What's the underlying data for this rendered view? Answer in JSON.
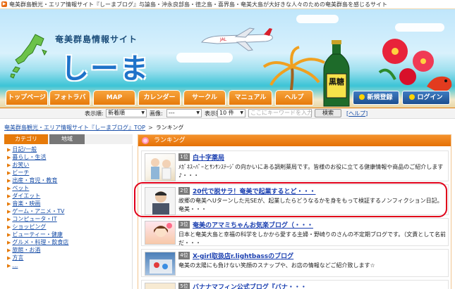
{
  "topbar": {
    "text": "奄美群島観光・エリア情報サイト『しーまブログ』与論島・沖永良部島・徳之島・喜界島・奄美大島が大好きな人々のための奄美群島を感じるサイト"
  },
  "header": {
    "subtitle": "奄美群島情報サイト",
    "title": "しーま",
    "bottle_label": "黒糖"
  },
  "nav": {
    "tabs": [
      "トップページ",
      "フォトラバ",
      "MAP",
      "カレンダー",
      "サークル",
      "マニュアル",
      "ヘルプ"
    ],
    "register": "新規登録",
    "login": "ログイン"
  },
  "options": {
    "display_label": "表示順:",
    "display_value": "新着順",
    "image_label": "画像:",
    "image_value": "---",
    "count_label": "表示数:",
    "count_value": "10 件",
    "keyword_placeholder": "ここにキーワードを入力",
    "search_button": "検索",
    "help_open": "[",
    "help": "ヘルプ",
    "help_close": "]"
  },
  "breadcrumb": {
    "home": "奄美群島観光・エリア情報サイト『しーまブログ』TOP",
    "separator": ">",
    "current": "ランキング"
  },
  "sidebar": {
    "tab_category": "カテゴリ",
    "tab_area": "地域",
    "items": [
      "日記/一般",
      "暮らし・生活",
      "お笑い",
      "ビーチ",
      "出産・育児・教育",
      "ペット",
      "ダイエット",
      "音楽・映画",
      "ゲーム・アニメ・TV",
      "コンピュータ・IT",
      "ショッピング",
      "ビューティー・健康",
      "グルメ・料理・飲食店",
      "旅館・お酒",
      "方言",
      "…"
    ]
  },
  "ranking": {
    "heading": "ランキング",
    "items": [
      {
        "rank": "1位",
        "title": "白十字薬局",
        "desc": "ﾒｶﾞﾈｽｰﾊﾟｰとｻﾝｻﾝｽﾃｰｼﾞの向かいにある調剤薬局です。皆様のお役に立てる健康情報や商品のご紹介します♪・・・"
      },
      {
        "rank": "2位",
        "title": "20代で脱サラ！奄美で起業するとど・・・",
        "desc": "故郷の奄美へUターンした元SEが、起業したらどうなるかを身をもって検証するノンフィクション日記。奄美・・・"
      },
      {
        "rank": "3位",
        "title": "奄美のアマミちゃんお気楽ブログ（・・・",
        "desc": "日本と奄美大島と幸福の科学をしかから愛する主婦・野崎りのさんの不定期ブログです。（文責として名前だ・・・"
      },
      {
        "rank": "4位",
        "title": "X-girl取扱店r.lightbassのブログ",
        "desc": "奄美の太陽にも負けない笑顔のスナップや、お店の情報などご紹介致します☆"
      },
      {
        "rank": "5位",
        "title": "バナナマフィン公式ブログ『バナ・・・",
        "desc": ""
      }
    ]
  }
}
